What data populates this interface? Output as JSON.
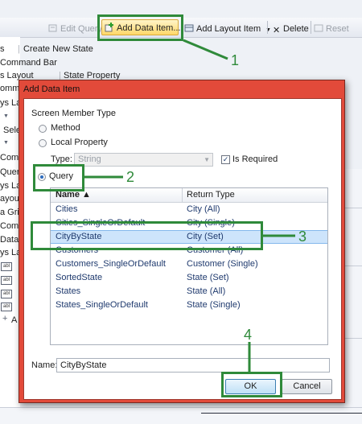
{
  "toolbar": {
    "edit_query": "Edit Query",
    "add_data_item": "Add Data Item...",
    "add_layout_item": "Add Layout Item",
    "delete": "Delete",
    "reset": "Reset"
  },
  "designer": {
    "breadcrumb_left": "s",
    "breadcrumb_right": "Create New State",
    "command_bar": "Command Bar",
    "layout_left": "s Layout",
    "state_property": "State Property",
    "left_fragments": [
      "ommar",
      "ys Lay",
      "Sele",
      "Query",
      "ys La",
      "ayout",
      "a Gri",
      "Comm",
      "Data",
      "ys Lay",
      "Comm",
      "A"
    ],
    "left_badges": [
      "abl",
      "abl",
      "abl",
      "abl"
    ]
  },
  "dialog": {
    "title": "Add Data Item",
    "section_label": "Screen Member Type",
    "options": {
      "method": "Method",
      "local_property": "Local Property",
      "query": "Query"
    },
    "selected_option": "query",
    "type_label": "Type:",
    "type_value": "String",
    "is_required_label": "Is Required",
    "is_required_checked": true,
    "columns": {
      "name": "Name ▲",
      "return_type": "Return Type"
    },
    "items": [
      {
        "name": "Cities",
        "return_type": "City (All)"
      },
      {
        "name": "Cities_SingleOrDefault",
        "return_type": "City (Single)"
      },
      {
        "name": "CityByState",
        "return_type": "City (Set)"
      },
      {
        "name": "Customers",
        "return_type": "Customer (All)"
      },
      {
        "name": "Customers_SingleOrDefault",
        "return_type": "Customer (Single)"
      },
      {
        "name": "SortedState",
        "return_type": "State (Set)"
      },
      {
        "name": "States",
        "return_type": "State (All)"
      },
      {
        "name": "States_SingleOrDefault",
        "return_type": "State (Single)"
      }
    ],
    "selected_item": "CityByState",
    "name_label": "Name:",
    "name_value": "CityByState",
    "ok_label": "OK",
    "cancel_label": "Cancel"
  },
  "annotations": {
    "one": "1",
    "two": "2",
    "three": "3",
    "four": "4"
  },
  "colors": {
    "annotation": "#2f8a3a",
    "dialog_frame": "#e24a3a",
    "selection": "#cde4fb"
  },
  "icons": [
    "edit-query-icon",
    "add-data-item-icon",
    "add-layout-item-icon",
    "delete-icon",
    "reset-icon",
    "sort-ascending-icon"
  ]
}
